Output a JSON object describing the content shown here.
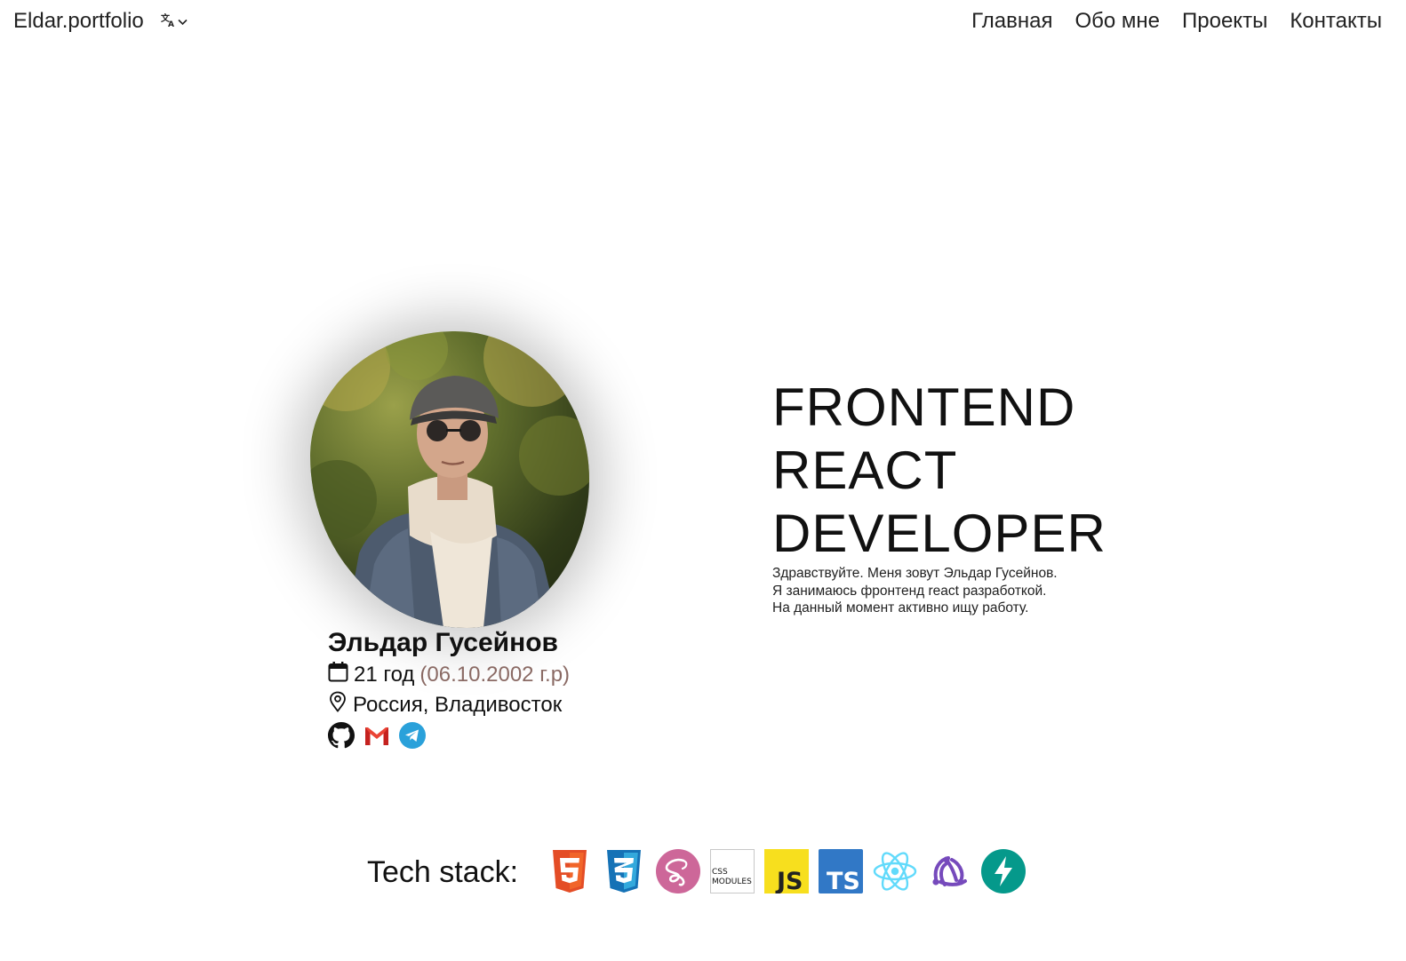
{
  "header": {
    "logo": "Eldar.portfolio",
    "lang_icon": "translate-icon",
    "nav": [
      {
        "label": "Главная"
      },
      {
        "label": "Обо мне"
      },
      {
        "label": "Проекты"
      },
      {
        "label": "Контакты"
      }
    ]
  },
  "profile": {
    "name": "Эльдар Гусейнов",
    "age": "21 год",
    "birth": "(06.10.2002 г.р)",
    "city": "Россия, Владивосток",
    "socials": [
      "github-icon",
      "gmail-icon",
      "telegram-icon"
    ]
  },
  "hero": {
    "lines": [
      "FRONTEND",
      "REACT",
      "DEVELOPER"
    ],
    "intro": [
      "Здравствуйте. Меня зовут Эльдар Гусейнов.",
      "Я занимаюсь фронтенд react разработкой.",
      "На данный момент активно ищу работу."
    ]
  },
  "stack": {
    "label": "Tech stack:",
    "icons": [
      "html5-icon",
      "css3-icon",
      "sass-icon",
      "css-modules-icon",
      "javascript-icon",
      "typescript-icon",
      "react-icon",
      "redux-icon",
      "vite-icon"
    ],
    "js_text": "JS",
    "ts_text": "TS",
    "css_modules_text": [
      "CSS",
      "MODULES"
    ]
  },
  "colors": {
    "html5": "#e44d26",
    "css3": "#1572b6",
    "sass": "#cd6799",
    "js": "#f7df1e",
    "ts": "#3178c6",
    "react": "#61dafb",
    "redux": "#764abc",
    "fastapi": "#05998b",
    "gmail": "#ea4335",
    "telegram": "#2aa1da",
    "birth": "#8a6a64"
  }
}
